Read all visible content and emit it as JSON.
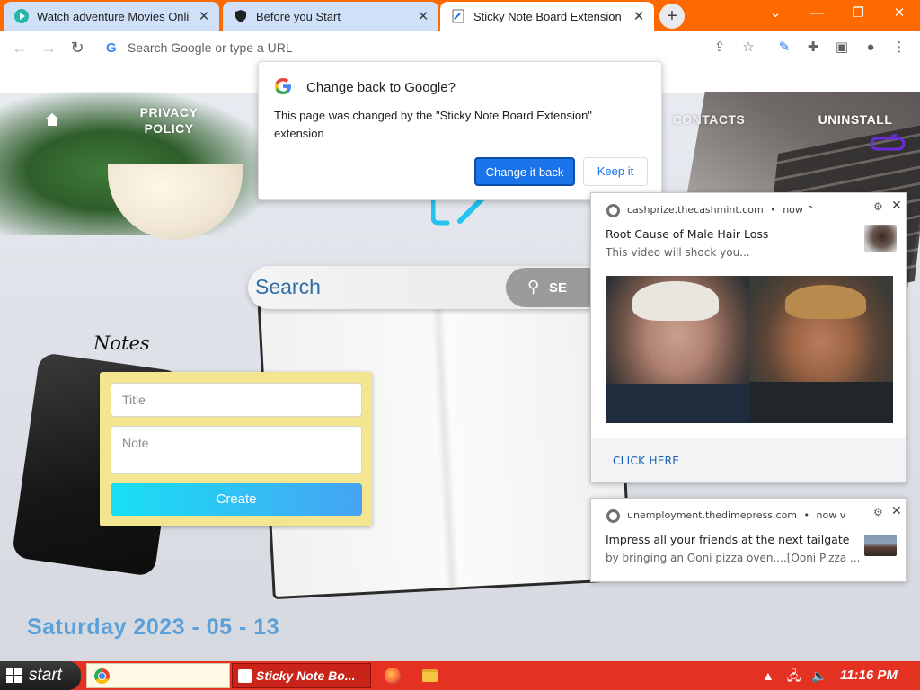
{
  "browser": {
    "tabs": [
      {
        "title": "Watch adventure Movies Onli",
        "active": false
      },
      {
        "title": "Before you Start",
        "active": false
      },
      {
        "title": "Sticky Note Board Extension",
        "active": true
      }
    ],
    "tab_close_glyph": "✕",
    "new_tab_glyph": "+",
    "omnibox_placeholder": "Search Google or type a URL",
    "window_controls": {
      "chevron": "⌄",
      "minimize": "—",
      "restore": "❐",
      "close": "✕"
    }
  },
  "page": {
    "nav": {
      "privacy": "PRIVACY\nPOLICY",
      "contacts": "CONTACTS",
      "uninstall": "UNINSTALL"
    },
    "search": {
      "placeholder": "Search",
      "button": "SE"
    },
    "notes": {
      "heading": "Notes",
      "title_placeholder": "Title",
      "note_placeholder": "Note",
      "create_label": "Create"
    },
    "date_label": "Saturday 2023 - 05 - 13"
  },
  "dialog": {
    "title": "Change back to Google?",
    "body": "This page was changed by the \"Sticky Note Board Extension\" extension",
    "primary": "Change it back",
    "secondary": "Keep it"
  },
  "notifications": [
    {
      "source": "cashprize.thecashmint.com",
      "time": "now",
      "expander": "^",
      "title": "Root Cause of Male Hair Loss",
      "body": "This video will shock you...",
      "cta": "CLICK HERE"
    },
    {
      "source": "unemployment.thedimepress.com",
      "time": "now",
      "expander": "v",
      "title": "Impress all your friends at the next tailgate",
      "body": "by bringing an Ooni pizza oven....[Ooni Pizza ..."
    }
  ],
  "notification_separator": "•",
  "taskbar": {
    "start_label": "start",
    "active_task": "Sticky Note Bo...",
    "clock": "11:16 PM"
  },
  "colors": {
    "taskbar": "#e53121",
    "tabstrip": "#ff6a00",
    "primary_button": "#1a73e8",
    "notes_card": "#f4e690",
    "date_text": "#5ba0d8"
  },
  "icons": [
    "back-icon",
    "forward-icon",
    "reload-icon",
    "google-g-icon",
    "share-icon",
    "star-icon",
    "extension-note-icon",
    "puzzle-icon",
    "sidebar-icon",
    "profile-icon",
    "menu-icon",
    "search-icon",
    "gear-icon",
    "close-icon",
    "windows-flag-icon",
    "chrome-icon",
    "firefox-icon",
    "folder-icon",
    "volume-icon",
    "network-icon"
  ]
}
